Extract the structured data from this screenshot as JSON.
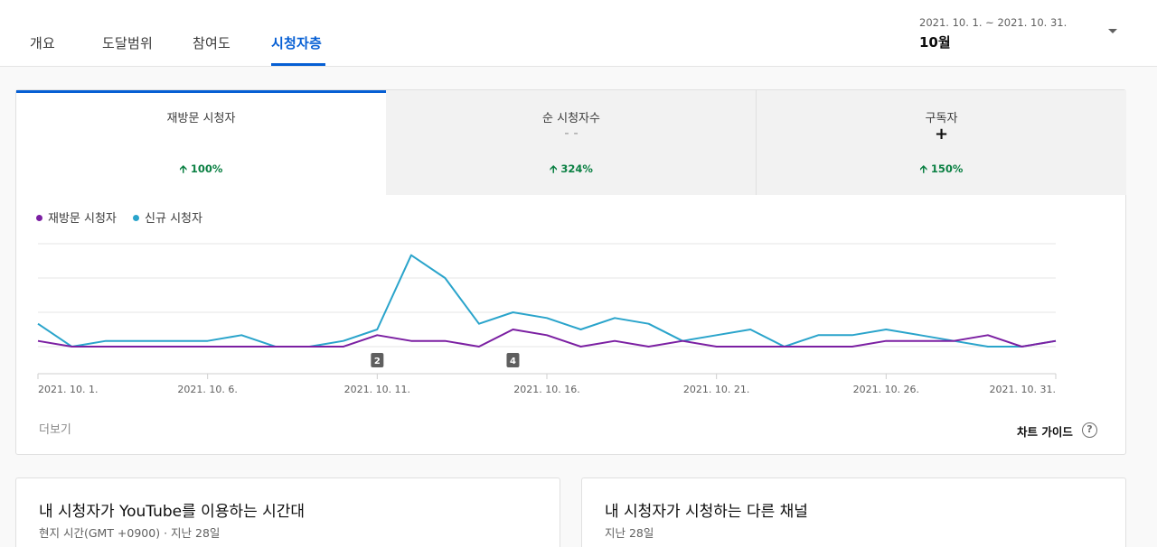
{
  "tabs": [
    {
      "label": "개요",
      "active": false
    },
    {
      "label": "도달범위",
      "active": false
    },
    {
      "label": "참여도",
      "active": false
    },
    {
      "label": "시청자층",
      "active": true
    }
  ],
  "period": {
    "range": "2021. 10. 1. ~ 2021. 10. 31.",
    "label": "10월",
    "dropdown_icon": "caret-down-icon"
  },
  "metrics": [
    {
      "title": "재방문 시청자",
      "value": "",
      "change": "100%",
      "trend": "up",
      "active": true
    },
    {
      "title": "순 시청자수",
      "value": "- -",
      "change": "324%",
      "trend": "up",
      "active": false
    },
    {
      "title": "구독자",
      "value": "+",
      "change": "150%",
      "trend": "up",
      "active": false
    }
  ],
  "legend": [
    {
      "label": "재방문 시청자",
      "color": "#7b1fa2"
    },
    {
      "label": "신규 시청자",
      "color": "#2aa4cb"
    }
  ],
  "chart_data": {
    "type": "line",
    "x": [
      "2021. 10. 1.",
      "2021. 10. 2.",
      "2021. 10. 3.",
      "2021. 10. 4.",
      "2021. 10. 5.",
      "2021. 10. 6.",
      "2021. 10. 7.",
      "2021. 10. 8.",
      "2021. 10. 9.",
      "2021. 10. 10.",
      "2021. 10. 11.",
      "2021. 10. 12.",
      "2021. 10. 13.",
      "2021. 10. 14.",
      "2021. 10. 15.",
      "2021. 10. 16.",
      "2021. 10. 17.",
      "2021. 10. 18.",
      "2021. 10. 19.",
      "2021. 10. 20.",
      "2021. 10. 21.",
      "2021. 10. 22.",
      "2021. 10. 23.",
      "2021. 10. 24.",
      "2021. 10. 25.",
      "2021. 10. 26.",
      "2021. 10. 27.",
      "2021. 10. 28.",
      "2021. 10. 29.",
      "2021. 10. 30.",
      "2021. 10. 31."
    ],
    "x_tick_labels": [
      "2021. 10. 1.",
      "2021. 10. 6.",
      "2021. 10. 11.",
      "2021. 10. 16.",
      "2021. 10. 21.",
      "2021. 10. 26.",
      "2021. 10. 31."
    ],
    "x_tick_index": [
      0,
      5,
      10,
      15,
      20,
      25,
      30
    ],
    "series": [
      {
        "name": "재방문 시청자",
        "color": "#7b1fa2",
        "values": [
          1,
          0,
          0,
          0,
          0,
          0,
          0,
          0,
          0,
          0,
          2,
          1,
          1,
          0,
          3,
          2,
          0,
          1,
          0,
          1,
          0,
          0,
          0,
          0,
          0,
          1,
          1,
          1,
          2,
          0,
          1
        ]
      },
      {
        "name": "신규 시청자",
        "color": "#2aa4cb",
        "values": [
          4,
          0,
          1,
          1,
          1,
          1,
          2,
          0,
          0,
          1,
          3,
          16,
          12,
          4,
          6,
          5,
          3,
          5,
          4,
          1,
          2,
          3,
          0,
          2,
          2,
          3,
          2,
          1,
          0,
          0,
          1
        ]
      }
    ],
    "ylim": [
      0,
      18
    ],
    "grid": true,
    "annotations": [
      {
        "index": 10,
        "label": "2"
      },
      {
        "index": 14,
        "label": "4"
      }
    ]
  },
  "more_link": "더보기",
  "chart_guide": {
    "label": "차트 가이드",
    "icon": "help-icon",
    "icon_glyph": "?"
  },
  "bottom_cards": [
    {
      "title": "내 시청자가 YouTube를 이용하는 시간대",
      "subtitle": "현지 시간(GMT +0900) · 지난 28일"
    },
    {
      "title": "내 시청자가 시청하는 다른 채널",
      "subtitle": "지난 28일"
    }
  ]
}
